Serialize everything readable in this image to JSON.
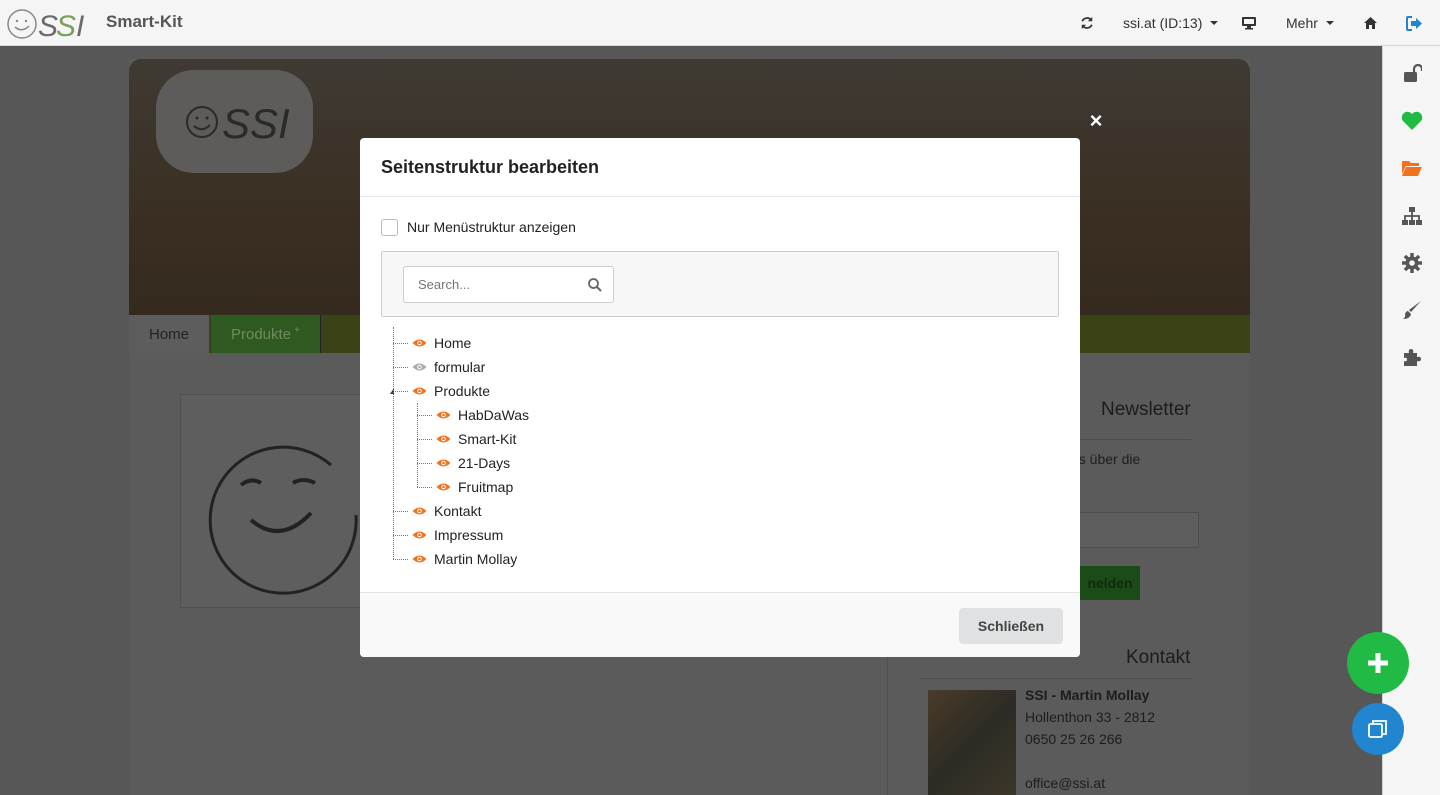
{
  "topbar": {
    "app_title": "Smart-Kit",
    "site_selector": "ssi.at (ID:13)",
    "more_label": "Mehr"
  },
  "background_page": {
    "nav_home": "Home",
    "nav_products": "Produkte",
    "newsletter_heading": "Newsletter",
    "newsletter_text": "os über die",
    "newsletter_button": "nelden",
    "contact_heading": "Kontakt",
    "contact_name": "SSI - Martin Mollay",
    "contact_address": "Hollenthon 33 - 2812",
    "contact_phone": "0650 25 26 266",
    "contact_email": "office@ssi.at"
  },
  "modal": {
    "title": "Seitenstruktur bearbeiten",
    "checkbox_label": "Nur Menüstruktur anzeigen",
    "search_placeholder": "Search...",
    "close_button": "Schließen",
    "tree": [
      {
        "label": "Home",
        "visible": true
      },
      {
        "label": "formular",
        "visible": false
      },
      {
        "label": "Produkte",
        "visible": true,
        "children": [
          {
            "label": "HabDaWas",
            "visible": true
          },
          {
            "label": "Smart-Kit",
            "visible": true
          },
          {
            "label": "21-Days",
            "visible": true
          },
          {
            "label": "Fruitmap",
            "visible": true
          }
        ]
      },
      {
        "label": "Kontakt",
        "visible": true
      },
      {
        "label": "Impressum",
        "visible": true
      },
      {
        "label": "Martin Mollay",
        "visible": true
      }
    ]
  },
  "colors": {
    "eye_visible": "#f2711c",
    "eye_hidden": "#aaaaaa",
    "fab_add": "#21ba45",
    "fab_copy": "#2185d0"
  }
}
